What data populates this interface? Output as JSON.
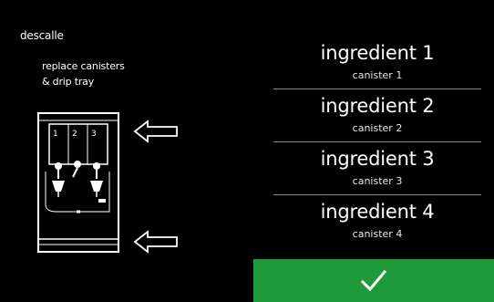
{
  "screen": {
    "title": "descalle",
    "instruction_line1": "replace canisters",
    "instruction_line2": "& drip tray"
  },
  "machine": {
    "slot_labels": [
      "1",
      "2",
      "3"
    ]
  },
  "ingredients": [
    {
      "name": "ingredient 1",
      "canister": "canister 1"
    },
    {
      "name": "ingredient 2",
      "canister": "canister 2"
    },
    {
      "name": "ingredient 3",
      "canister": "canister 3"
    },
    {
      "name": "ingredient 4",
      "canister": "canister 4"
    }
  ],
  "confirm": {
    "icon": "checkmark-icon",
    "color": "#1f9a3a"
  },
  "colors": {
    "background": "#000000",
    "text": "#ffffff",
    "accent": "#1f9a3a",
    "divider": "#8a8a8a"
  }
}
